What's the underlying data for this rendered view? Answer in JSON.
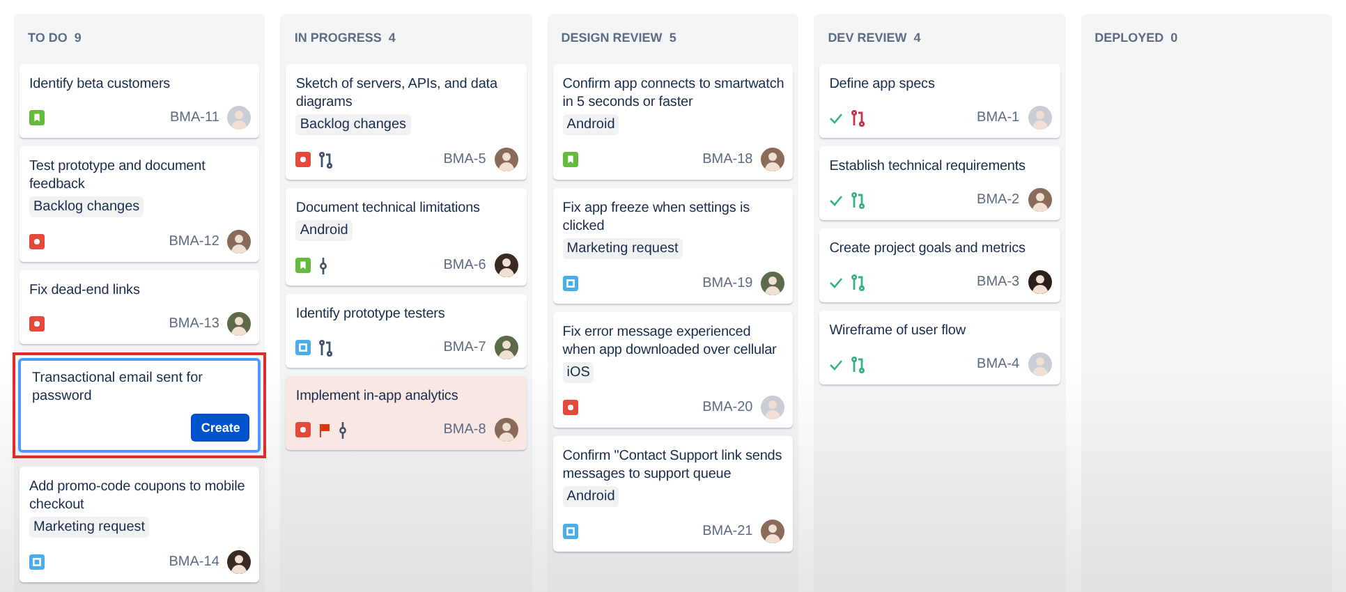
{
  "columns": [
    {
      "title": "TO DO",
      "count": "9",
      "cards": [
        {
          "kind": "issue",
          "title": "Identify beta customers",
          "icons": [
            {
              "kind": "story"
            }
          ],
          "key": "BMA-11",
          "avatar": {
            "color": "#c9ced6"
          },
          "flagged": false
        },
        {
          "kind": "issue",
          "title": "Test prototype and document feedback",
          "label": "Backlog changes",
          "icons": [
            {
              "kind": "bug"
            }
          ],
          "key": "BMA-12",
          "avatar": {
            "color": "#8a6a58"
          },
          "flagged": false
        },
        {
          "kind": "issue",
          "title": "Fix dead-end links",
          "icons": [
            {
              "kind": "bug"
            }
          ],
          "key": "BMA-13",
          "avatar": {
            "color": "#5d6b4a"
          },
          "flagged": false
        },
        {
          "kind": "composer",
          "value": "Transactional email sent for password",
          "button": "Create",
          "highlighted": true
        },
        {
          "kind": "issue",
          "title": "Add promo-code coupons to mobile checkout",
          "label": "Marketing request",
          "icons": [
            {
              "kind": "task"
            }
          ],
          "key": "BMA-14",
          "avatar": {
            "color": "#3a2a24"
          },
          "flagged": false
        }
      ]
    },
    {
      "title": "IN PROGRESS",
      "count": "4",
      "cards": [
        {
          "kind": "issue",
          "title": "Sketch of servers, APIs, and data diagrams",
          "label": "Backlog changes",
          "icons": [
            {
              "kind": "bug"
            },
            {
              "kind": "branch",
              "color": "#42526e"
            }
          ],
          "key": "BMA-5",
          "avatar": {
            "color": "#8a6a58"
          },
          "flagged": false
        },
        {
          "kind": "issue",
          "title": "Document technical limitations",
          "label": "Android",
          "icons": [
            {
              "kind": "story"
            },
            {
              "kind": "commit",
              "color": "#42526e"
            }
          ],
          "key": "BMA-6",
          "avatar": {
            "color": "#3a2a24"
          },
          "flagged": false
        },
        {
          "kind": "issue",
          "title": "Identify prototype testers",
          "icons": [
            {
              "kind": "task"
            },
            {
              "kind": "branch",
              "color": "#42526e"
            }
          ],
          "key": "BMA-7",
          "avatar": {
            "color": "#5d6b4a"
          },
          "flagged": false
        },
        {
          "kind": "issue",
          "title": "Implement in-app analytics",
          "icons": [
            {
              "kind": "bug"
            },
            {
              "kind": "commit",
              "color": "#42526e"
            }
          ],
          "key": "BMA-8",
          "avatar": {
            "color": "#8a6a58"
          },
          "flagged": true
        }
      ]
    },
    {
      "title": "DESIGN REVIEW",
      "count": "5",
      "cards": [
        {
          "kind": "issue",
          "title": "Confirm app connects to smartwatch in 5 seconds or faster",
          "label": "Android",
          "icons": [
            {
              "kind": "story"
            }
          ],
          "key": "BMA-18",
          "avatar": {
            "color": "#8a6a58"
          },
          "flagged": false
        },
        {
          "kind": "issue",
          "title": "Fix app freeze when settings is clicked",
          "label": "Marketing request",
          "icons": [
            {
              "kind": "task"
            }
          ],
          "key": "BMA-19",
          "avatar": {
            "color": "#5d6b4a"
          },
          "flagged": false
        },
        {
          "kind": "issue",
          "title": "Fix error message experienced when app downloaded over cellular",
          "label": "iOS",
          "icons": [
            {
              "kind": "bug"
            }
          ],
          "key": "BMA-20",
          "avatar": {
            "color": "#c9ced6"
          },
          "flagged": false
        },
        {
          "kind": "issue",
          "title": "Confirm \"Contact Support link sends messages to support queue",
          "label": "Android",
          "icons": [
            {
              "kind": "task"
            }
          ],
          "key": "BMA-21",
          "avatar": {
            "color": "#8a6a58"
          },
          "flagged": false
        }
      ]
    },
    {
      "title": "DEV REVIEW",
      "count": "4",
      "cards": [
        {
          "kind": "issue",
          "title": "Define app specs",
          "icons": [
            {
              "kind": "check",
              "color": "#36b37e"
            },
            {
              "kind": "branch",
              "color": "#c9304a"
            }
          ],
          "key": "BMA-1",
          "avatar": {
            "color": "#c9ced6"
          },
          "flagged": false
        },
        {
          "kind": "issue",
          "title": "Establish technical requirements",
          "icons": [
            {
              "kind": "check",
              "color": "#36b37e"
            },
            {
              "kind": "branch",
              "color": "#36b37e"
            }
          ],
          "key": "BMA-2",
          "avatar": {
            "color": "#8a6a58"
          },
          "flagged": false
        },
        {
          "kind": "issue",
          "title": "Create project goals and metrics",
          "icons": [
            {
              "kind": "check",
              "color": "#36b37e"
            },
            {
              "kind": "branch",
              "color": "#36b37e"
            }
          ],
          "key": "BMA-3",
          "avatar": {
            "color": "#2a1f1a"
          },
          "flagged": false
        },
        {
          "kind": "issue",
          "title": "Wireframe of user flow",
          "icons": [
            {
              "kind": "check",
              "color": "#36b37e"
            },
            {
              "kind": "branch",
              "color": "#36b37e"
            }
          ],
          "key": "BMA-4",
          "avatar": {
            "color": "#c9ced6"
          },
          "flagged": false
        }
      ]
    },
    {
      "title": "DEPLOYED",
      "count": "0"
    }
  ]
}
